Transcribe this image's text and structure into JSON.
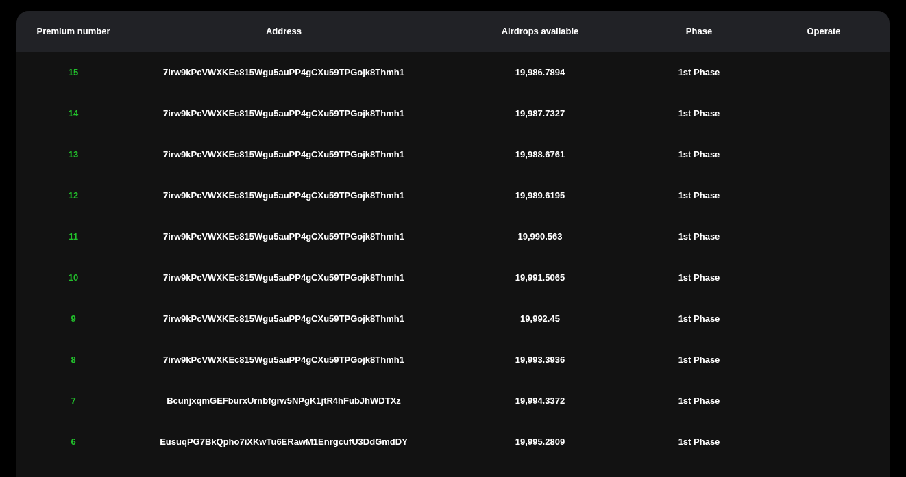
{
  "table": {
    "columns": [
      "Premium number",
      "Address",
      "Airdrops available",
      "Phase",
      "Operate"
    ],
    "rows": [
      {
        "number": "15",
        "address": "7irw9kPcVWXKEc815Wgu5auPP4gCXu59TPGojk8Thmh1",
        "airdrops": "19,986.7894",
        "phase": "1st Phase"
      },
      {
        "number": "14",
        "address": "7irw9kPcVWXKEc815Wgu5auPP4gCXu59TPGojk8Thmh1",
        "airdrops": "19,987.7327",
        "phase": "1st Phase"
      },
      {
        "number": "13",
        "address": "7irw9kPcVWXKEc815Wgu5auPP4gCXu59TPGojk8Thmh1",
        "airdrops": "19,988.6761",
        "phase": "1st Phase"
      },
      {
        "number": "12",
        "address": "7irw9kPcVWXKEc815Wgu5auPP4gCXu59TPGojk8Thmh1",
        "airdrops": "19,989.6195",
        "phase": "1st Phase"
      },
      {
        "number": "11",
        "address": "7irw9kPcVWXKEc815Wgu5auPP4gCXu59TPGojk8Thmh1",
        "airdrops": "19,990.563",
        "phase": "1st Phase"
      },
      {
        "number": "10",
        "address": "7irw9kPcVWXKEc815Wgu5auPP4gCXu59TPGojk8Thmh1",
        "airdrops": "19,991.5065",
        "phase": "1st Phase"
      },
      {
        "number": "9",
        "address": "7irw9kPcVWXKEc815Wgu5auPP4gCXu59TPGojk8Thmh1",
        "airdrops": "19,992.45",
        "phase": "1st Phase"
      },
      {
        "number": "8",
        "address": "7irw9kPcVWXKEc815Wgu5auPP4gCXu59TPGojk8Thmh1",
        "airdrops": "19,993.3936",
        "phase": "1st Phase"
      },
      {
        "number": "7",
        "address": "BcunjxqmGEFburxUrnbfgrw5NPgK1jtR4hFubJhWDTXz",
        "airdrops": "19,994.3372",
        "phase": "1st Phase"
      },
      {
        "number": "6",
        "address": "EusuqPG7BkQpho7iXKwTu6ERawM1EnrgcufU3DdGmdDY",
        "airdrops": "19,995.2809",
        "phase": "1st Phase"
      }
    ]
  }
}
